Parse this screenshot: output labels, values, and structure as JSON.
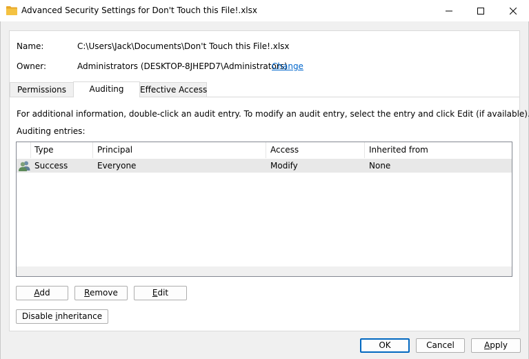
{
  "window": {
    "title": "Advanced Security Settings for Don't Touch this File!.xlsx",
    "minimize_glyph": "—",
    "maximize_glyph": "☐",
    "close_glyph": "✕"
  },
  "info": {
    "name_label": "Name:",
    "name_value": "C:\\Users\\Jack\\Documents\\Don't Touch this File!.xlsx",
    "owner_label": "Owner:",
    "owner_value": "Administrators (DESKTOP-8JHEPD7\\Administrators)",
    "change_link": "Change"
  },
  "tabs": [
    {
      "label": "Permissions",
      "active": false
    },
    {
      "label": "Auditing",
      "active": true
    },
    {
      "label": "Effective Access",
      "active": false
    }
  ],
  "auditing": {
    "instructions": "For additional information, double-click an audit entry. To modify an audit entry, select the entry and click Edit (if available).",
    "entries_label": "Auditing entries:",
    "columns": [
      "Type",
      "Principal",
      "Access",
      "Inherited from"
    ],
    "rows": [
      {
        "icon": "users-icon",
        "type": "Success",
        "principal": "Everyone",
        "access": "Modify",
        "inherited_from": "None"
      }
    ]
  },
  "buttons": {
    "add_prefix": "",
    "add_mnemonic": "A",
    "add_suffix": "dd",
    "remove_prefix": "",
    "remove_mnemonic": "R",
    "remove_suffix": "emove",
    "edit_prefix": "",
    "edit_mnemonic": "E",
    "edit_suffix": "dit",
    "disable_prefix": "Disable ",
    "disable_mnemonic": "i",
    "disable_suffix": "nheritance",
    "ok": "OK",
    "cancel": "Cancel",
    "apply_prefix": "",
    "apply_mnemonic": "A",
    "apply_suffix": "pply"
  },
  "colors": {
    "link": "#0066cc",
    "default_button_border": "#0067c0",
    "folder_icon": "#f4c242"
  }
}
